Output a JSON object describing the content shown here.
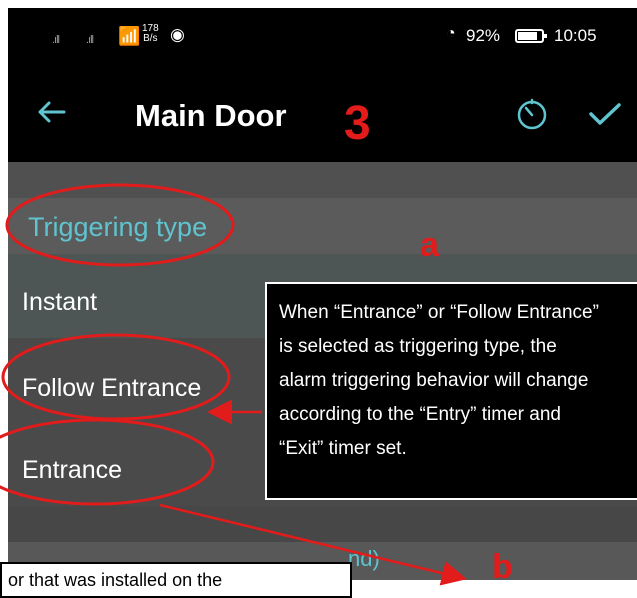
{
  "status_bar": {
    "signal_1": ".ıll",
    "signal_2": ".ıll",
    "wifi_icon": "wifi-icon",
    "net_speed_value": "178",
    "net_speed_unit": "B/s",
    "eye_icon": "eye-icon",
    "battery_percent": "92%",
    "time": "10:05"
  },
  "app_bar": {
    "title": "Main Door",
    "step_number": "3",
    "accent_color": "#5fc4cf"
  },
  "section": {
    "header": "Triggering type",
    "options": [
      {
        "label": "Instant"
      },
      {
        "label": "Follow Entrance"
      },
      {
        "label": "Entrance"
      }
    ],
    "partial_label": "nd)"
  },
  "annotations": {
    "letter_a": "a",
    "letter_b": "b",
    "color": "#e21b1b",
    "callout_lines": [
      "When “Entrance” or “Follow Entrance”",
      "is selected as triggering type, the",
      "alarm triggering behavior will change",
      "according to the “Entry” timer and",
      "“Exit” timer set."
    ],
    "bottom_note": "or that was installed on the"
  }
}
